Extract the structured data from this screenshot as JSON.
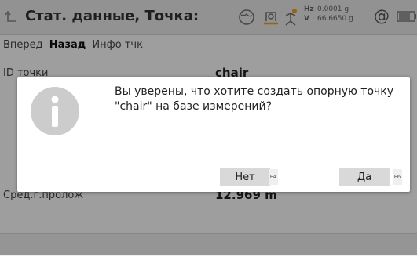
{
  "header": {
    "title": "Стат. данные, Точка:",
    "hz_label": "Hz",
    "hz_value": "0.0001 g",
    "v_label": "V",
    "v_value": "66.6650 g",
    "at_symbol": "@"
  },
  "tabs": [
    "Вперед",
    "Назад",
    "Инфо тчк"
  ],
  "fields": {
    "point_id": {
      "label": "ID точки",
      "value": "chair"
    },
    "avg_distance": {
      "label": "Сред.г.пролож",
      "value": "12.969 m"
    }
  },
  "dialog": {
    "message": "Вы уверены, что хотите создать опорную точку \"chair\" на базе измерений?",
    "no_label": "Нет",
    "no_fkey": "F4",
    "yes_label": "Да",
    "yes_fkey": "F6"
  },
  "icons": {
    "back": "back-arrow-icon",
    "info": "info-icon",
    "network": "network-globe-icon",
    "measure": "measure-icon",
    "prism": "prism-tripod-icon",
    "battery": "battery-icon"
  },
  "colors": {
    "accent": "#f5a020",
    "dialog_button": "#d9d9d9",
    "info_circle": "#cccccc"
  }
}
